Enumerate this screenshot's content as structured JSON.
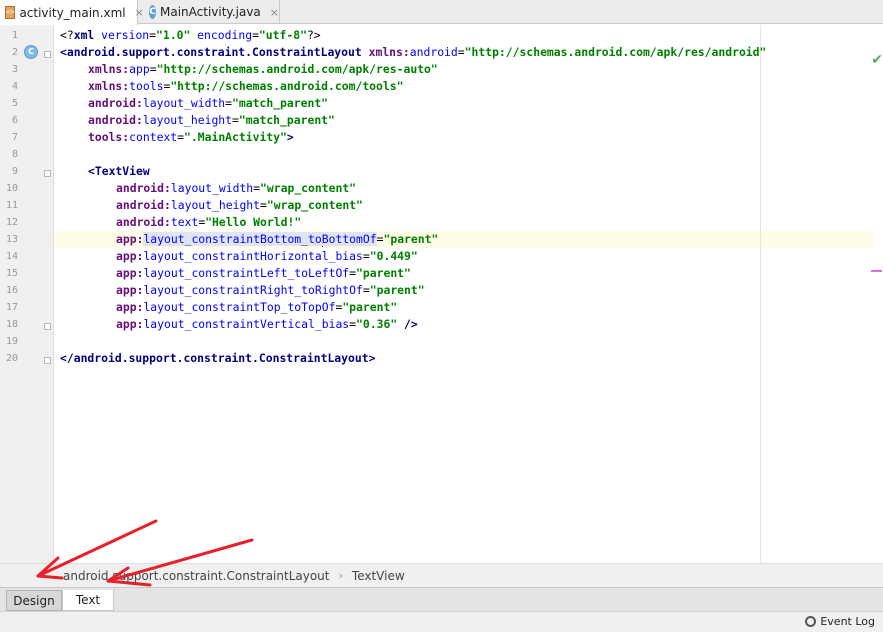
{
  "tabs": [
    {
      "label": "activity_main.xml",
      "icon": "xml-file-icon",
      "active": true
    },
    {
      "label": "MainActivity.java",
      "icon": "java-class-icon",
      "active": false
    }
  ],
  "gutter": {
    "line_numbers": [
      "1",
      "2",
      "3",
      "4",
      "5",
      "6",
      "7",
      "8",
      "9",
      "10",
      "11",
      "12",
      "13",
      "14",
      "15",
      "16",
      "17",
      "18",
      "19",
      "20"
    ],
    "class_marker": "C"
  },
  "code": {
    "line1": {
      "a": "<?",
      "b": "xml ",
      "c": "version",
      "d": "=",
      "e": "\"1.0\"",
      "f": " encoding",
      "g": "=",
      "h": "\"utf-8\"",
      "i": "?>"
    },
    "line2": {
      "a": "<android.support.constraint.ConstraintLayout ",
      "b": "xmlns:",
      "c": "android",
      "d": "=",
      "e": "\"http://schemas.android.com/apk/res/android\""
    },
    "line3": {
      "a": "xmlns:",
      "b": "app",
      "c": "=",
      "d": "\"http://schemas.android.com/apk/res-auto\""
    },
    "line4": {
      "a": "xmlns:",
      "b": "tools",
      "c": "=",
      "d": "\"http://schemas.android.com/tools\""
    },
    "line5": {
      "a": "android:",
      "b": "layout_width",
      "c": "=",
      "d": "\"match_parent\""
    },
    "line6": {
      "a": "android:",
      "b": "layout_height",
      "c": "=",
      "d": "\"match_parent\""
    },
    "line7": {
      "a": "tools:",
      "b": "context",
      "c": "=",
      "d": "\".MainActivity\"",
      "e": ">"
    },
    "line9": {
      "a": "<TextView"
    },
    "line10": {
      "a": "android:",
      "b": "layout_width",
      "c": "=",
      "d": "\"wrap_content\""
    },
    "line11": {
      "a": "android:",
      "b": "layout_height",
      "c": "=",
      "d": "\"wrap_content\""
    },
    "line12": {
      "a": "android:",
      "b": "text",
      "c": "=",
      "d": "\"Hello World!\""
    },
    "line13": {
      "a": "app:",
      "b": "layout_constraintBottom_to",
      "b2": "BottomOf",
      "c": "=",
      "d": "\"parent\""
    },
    "line14": {
      "a": "app:",
      "b": "layout_constraintHorizontal_bias",
      "c": "=",
      "d": "\"0.449\""
    },
    "line15": {
      "a": "app:",
      "b": "layout_constraintLeft_toLeftOf",
      "c": "=",
      "d": "\"parent\""
    },
    "line16": {
      "a": "app:",
      "b": "layout_constraintRight_toRightOf",
      "c": "=",
      "d": "\"parent\""
    },
    "line17": {
      "a": "app:",
      "b": "layout_constraintTop_toTopOf",
      "c": "=",
      "d": "\"parent\""
    },
    "line18": {
      "a": "app:",
      "b": "layout_constraintVertical_bias",
      "c": "=",
      "d": "\"0.36\"",
      "e": " />"
    },
    "line20": {
      "a": "</android.support.constraint.ConstraintLayout>"
    }
  },
  "breadcrumb": {
    "items": [
      "android.support.constraint.ConstraintLayout",
      "TextView"
    ],
    "separator": "›"
  },
  "bottom_tabs": {
    "design": "Design",
    "text": "Text"
  },
  "status": {
    "event_log": "Event Log"
  },
  "colors": {
    "tag": "#000080",
    "attribute": "#0000ff",
    "namespace": "#660e7a",
    "value": "#008000",
    "annotation_arrow": "#e8202a"
  }
}
